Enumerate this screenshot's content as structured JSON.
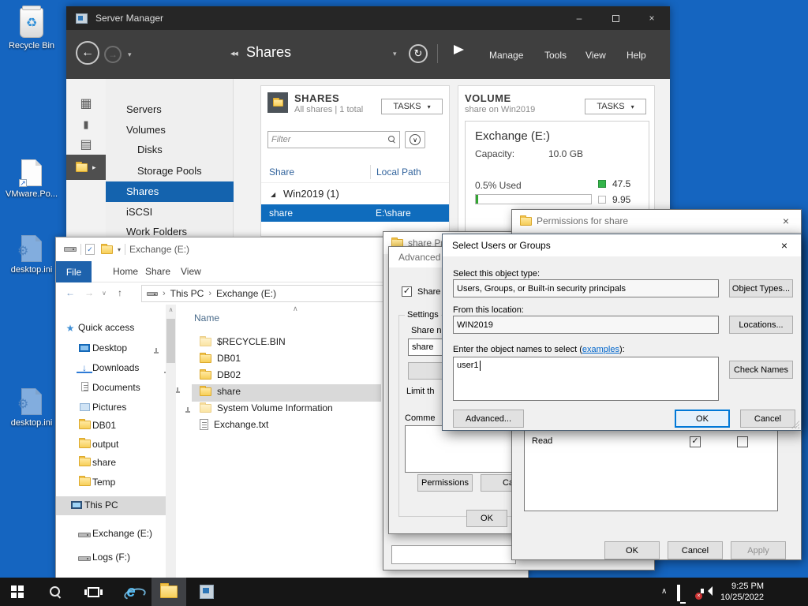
{
  "colors": {
    "desktop_bg": "#1565c0",
    "selection_blue": "#0f6cbd",
    "file_tab_blue": "#1e62ac",
    "used_green": "#33a532"
  },
  "icons": {
    "refresh": "↻",
    "back": "←",
    "forward": "→",
    "up": "↑",
    "chevron_down": "∨",
    "sort_asc": "∧",
    "close": "×",
    "minimize": "–",
    "breadcrumb_sep": "›",
    "group_expanded": "◢",
    "tasks_caret": "▾",
    "scroll_up": "∧",
    "recycle": "♻",
    "gear": "⚙",
    "shortcut_arrow": "↗",
    "check": "✓",
    "tray_chevron": "∧",
    "qat_caret": "▾",
    "nav_double_arrow": "◀◀"
  },
  "desktop": {
    "icons": [
      {
        "label": "Recycle Bin"
      },
      {
        "label": "VMware.Po..."
      },
      {
        "label": "desktop.ini"
      },
      {
        "label": "desktop.ini"
      }
    ]
  },
  "server_manager": {
    "window_title": "Server Manager",
    "breadcrumb": "Shares",
    "menus": [
      "Manage",
      "Tools",
      "View",
      "Help"
    ],
    "sidebar": {
      "items": [
        "Servers",
        "Volumes",
        "Disks",
        "Storage Pools",
        "Shares",
        "iSCSI",
        "Work Folders"
      ]
    },
    "shares_panel": {
      "title": "SHARES",
      "subtitle": "All shares | 1 total",
      "tasks": "TASKS",
      "filter_placeholder": "Filter",
      "col_share": "Share",
      "col_path": "Local Path",
      "group": "Win2019 (1)",
      "row": {
        "share": "share",
        "path": "E:\\share"
      }
    },
    "volume_panel": {
      "title": "VOLUME",
      "subtitle": "share on Win2019",
      "tasks": "TASKS",
      "name": "Exchange (E:)",
      "capacity_label": "Capacity:",
      "capacity": "10.0 GB",
      "used": "0.5% Used",
      "legend_used": "47.5",
      "legend_free": "9.95"
    }
  },
  "file_explorer": {
    "window_title": "Exchange (E:)",
    "tabs": {
      "file": "File",
      "home": "Home",
      "share": "Share",
      "view": "View"
    },
    "breadcrumb": {
      "root": "This PC",
      "current": "Exchange (E:)"
    },
    "nav": {
      "items": [
        "Quick access",
        "Desktop",
        "Downloads",
        "Documents",
        "Pictures",
        "DB01",
        "output",
        "share",
        "Temp",
        "This PC",
        "Exchange (E:)",
        "Logs (F:)"
      ]
    },
    "list": {
      "header": "Name",
      "files": [
        "$RECYCLE.BIN",
        "DB01",
        "DB02",
        "share",
        "System Volume Information",
        "Exchange.txt"
      ]
    }
  },
  "properties_dialog": {
    "title": "share Pro"
  },
  "advanced_sharing": {
    "title": "Advanced S",
    "share_this": "Share th",
    "settings": "Settings",
    "share_name": "Share n",
    "share_value": "share",
    "add": "Ad",
    "limit": "Limit th",
    "comments": "Comme",
    "permissions": "Permissions",
    "caching": "Ca",
    "ok": "OK"
  },
  "permissions_dialog": {
    "title": "Permissions for share",
    "read": "Read",
    "ok": "OK",
    "cancel": "Cancel",
    "apply": "Apply"
  },
  "select_users_dialog": {
    "title": "Select Users or Groups",
    "object_type_label": "Select this object type:",
    "object_type_value": "Users, Groups, or Built-in security principals",
    "object_types_btn": "Object Types...",
    "location_label": "From this location:",
    "location_value": "WIN2019",
    "locations_btn": "Locations...",
    "names_label_pre": "Enter the object names to select (",
    "names_link": "examples",
    "names_label_post": "):",
    "names_value": "user1",
    "check_names_btn": "Check Names",
    "advanced_btn": "Advanced...",
    "ok": "OK",
    "cancel": "Cancel"
  },
  "taskbar": {
    "time": "9:25 PM",
    "date": "10/25/2022"
  }
}
